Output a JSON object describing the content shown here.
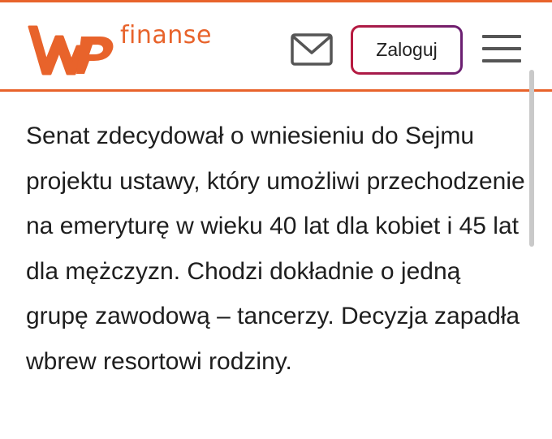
{
  "header": {
    "brand_name": "finanse",
    "logo_icon": "wp-logo-icon",
    "mail_icon": "mail-icon",
    "login_label": "Zaloguj",
    "menu_icon": "hamburger-menu-icon"
  },
  "article": {
    "text": "Senat zdecydował o wniesieniu do Sejmu projektu ustawy, który umożliwi przechodzenie na emeryturę w wieku 40 lat dla kobiet i 45 lat dla mężczyzn. Chodzi dokładnie o jedną grupę zawodową – tancerzy. Decyzja zapadła wbrew resortowi rodziny."
  },
  "colors": {
    "brand_orange": "#e8632b",
    "login_border_start": "#b81a3f",
    "login_border_end": "#6a1f72",
    "text": "#1e1e1e",
    "icon_gray": "#555555"
  }
}
